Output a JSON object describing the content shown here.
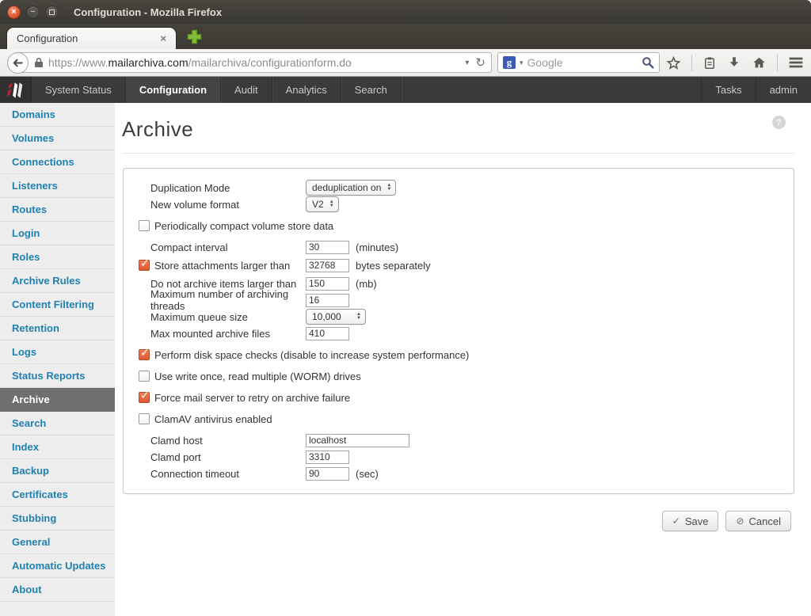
{
  "icons": {
    "check": "✓",
    "cancel": "⊘",
    "close_x": "×",
    "minimize": "−",
    "dropdown": "▾",
    "reload": "↻",
    "back": "←",
    "up_arrow": "▲",
    "down_arrow": "▼",
    "help": "?",
    "google_initial": "g"
  },
  "colors": {
    "checkbox_checked": "#e0603c",
    "sidebar_link": "#2080b0",
    "nav_background": "#3a3a3a",
    "active_sidebar_bg": "#6f6f6f"
  },
  "window": {
    "title": "Configuration - Mozilla Firefox"
  },
  "browser": {
    "tab_title": "Configuration",
    "url_scheme": "https://www.",
    "url_domain": "mailarchiva.com",
    "url_path": "/mailarchiva/configurationform.do",
    "search_placeholder": "Google"
  },
  "appnav": {
    "items": [
      {
        "label": "System Status",
        "active": false
      },
      {
        "label": "Configuration",
        "active": true
      },
      {
        "label": "Audit",
        "active": false
      },
      {
        "label": "Analytics",
        "active": false
      },
      {
        "label": "Search",
        "active": false
      }
    ],
    "right": [
      {
        "label": "Tasks",
        "active": false
      },
      {
        "label": "admin",
        "active": false
      }
    ]
  },
  "sidebar": {
    "items": [
      {
        "label": "Domains",
        "active": false
      },
      {
        "label": "Volumes",
        "active": false
      },
      {
        "label": "Connections",
        "active": false
      },
      {
        "label": "Listeners",
        "active": false
      },
      {
        "label": "Routes",
        "active": false
      },
      {
        "label": "Login",
        "active": false
      },
      {
        "label": "Roles",
        "active": false
      },
      {
        "label": "Archive Rules",
        "active": false
      },
      {
        "label": "Content Filtering",
        "active": false
      },
      {
        "label": "Retention",
        "active": false
      },
      {
        "label": "Logs",
        "active": false
      },
      {
        "label": "Status Reports",
        "active": false
      },
      {
        "label": "Archive",
        "active": true
      },
      {
        "label": "Search",
        "active": false
      },
      {
        "label": "Index",
        "active": false
      },
      {
        "label": "Backup",
        "active": false
      },
      {
        "label": "Certificates",
        "active": false
      },
      {
        "label": "Stubbing",
        "active": false
      },
      {
        "label": "General",
        "active": false
      },
      {
        "label": "Automatic Updates",
        "active": false
      },
      {
        "label": "About",
        "active": false
      }
    ]
  },
  "main": {
    "title": "Archive",
    "rows": [
      {
        "id": "duplication-mode",
        "type": "select",
        "label": "Duplication Mode",
        "value": "deduplication on"
      },
      {
        "id": "new-volume-format",
        "type": "select",
        "label": "New volume format",
        "value": "V2"
      },
      {
        "id": "compact-volume-store",
        "type": "checkbox",
        "label": "Periodically compact volume store data",
        "checked": false
      },
      {
        "id": "compact-interval",
        "type": "field",
        "label": "Compact interval",
        "value": "30",
        "suffix": "(minutes)"
      },
      {
        "id": "store-attachments-larger",
        "type": "checkbox-field",
        "label": "Store attachments larger than",
        "checked": true,
        "value": "32768",
        "suffix": "bytes separately"
      },
      {
        "id": "max-item-size",
        "type": "field",
        "label": "Do not archive items larger than",
        "value": "150",
        "suffix": "(mb)"
      },
      {
        "id": "max-archiving-threads",
        "type": "field",
        "label": "Maximum number of archiving threads",
        "value": "16"
      },
      {
        "id": "max-queue-size",
        "type": "spinner",
        "label": "Maximum queue size",
        "value": "10,000"
      },
      {
        "id": "max-mounted-archive-files",
        "type": "field",
        "label": "Max mounted archive files",
        "value": "410"
      },
      {
        "id": "disk-space-checks",
        "type": "checkbox",
        "label": "Perform disk space checks (disable to increase system performance)",
        "checked": true
      },
      {
        "id": "worm-drives",
        "type": "checkbox",
        "label": "Use write once, read multiple (WORM) drives",
        "checked": false
      },
      {
        "id": "retry-on-failure",
        "type": "checkbox",
        "label": "Force mail server to retry on archive failure",
        "checked": true
      },
      {
        "id": "clamav-enabled",
        "type": "checkbox",
        "label": "ClamAV antivirus enabled",
        "checked": false
      },
      {
        "id": "clamd-host",
        "type": "field",
        "label": "Clamd host",
        "value": "localhost"
      },
      {
        "id": "clamd-port",
        "type": "field",
        "label": "Clamd port",
        "value": "3310"
      },
      {
        "id": "connection-timeout",
        "type": "field",
        "label": "Connection timeout",
        "value": "90",
        "suffix": "(sec)"
      }
    ],
    "save_label": "Save",
    "cancel_label": "Cancel"
  }
}
